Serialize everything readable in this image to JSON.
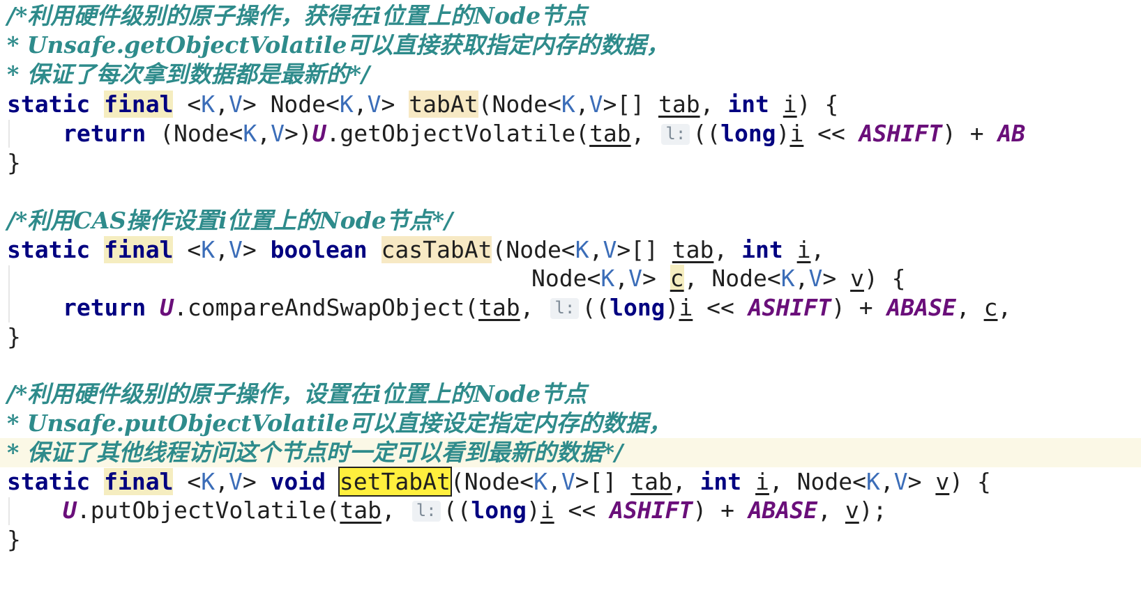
{
  "block1": {
    "c1": "/*利用硬件级别的原子操作，获得在i位置上的Node节点",
    "c2": "* Unsafe.getObjectVolatile可以直接获取指定内存的数据，",
    "c3": "* 保证了每次拿到数据都是最新的*/",
    "static": "static",
    "final": "final",
    "generics": "<K,V>",
    "type": "Node<K,V>",
    "name": "tabAt",
    "sig_open": "(Node<K,V>[] ",
    "p_tab": "tab",
    "comma": ", ",
    "int": "int",
    "p_i": "i",
    "sig_close": ") {",
    "return": "return",
    "cast": "(Node<K,V>)",
    "U": "U",
    "call": ".getObjectVolatile(",
    "hint": "l:",
    "long_open": "((",
    "long": "long",
    "long_close": ")",
    "shift": " << ",
    "ashift": "ASHIFT",
    "plus": ") + ",
    "abase_cut": "AB",
    "close": "}"
  },
  "block2": {
    "c1": "/*利用CAS操作设置i位置上的Node节点*/",
    "static": "static",
    "final": "final",
    "generics": "<K,V>",
    "boolean": "boolean",
    "name": "casTabAt",
    "sig_open": "(Node<K,V>[] ",
    "p_tab": "tab",
    "int": "int",
    "p_i": "i",
    "line2_type": "Node<K,V> ",
    "p_c": "c",
    "line2_type2": "Node<K,V> ",
    "p_v": "v",
    "sig_close": ") {",
    "return": "return",
    "U": "U",
    "call": ".compareAndSwapObject(",
    "hint": "l:",
    "long": "long",
    "ashift": "ASHIFT",
    "abase": "ABASE",
    "close": "}"
  },
  "block3": {
    "c1": "/*利用硬件级别的原子操作，设置在i位置上的Node节点",
    "c2": "* Unsafe.putObjectVolatile可以直接设定指定内存的数据，",
    "c3": "* 保证了其他线程访问这个节点时一定可以看到最新的数据*/",
    "static": "static",
    "final": "final",
    "generics": "<K,V>",
    "void": "void",
    "name": "setTabAt",
    "sig_open": "(Node<K,V>[] ",
    "p_tab": "tab",
    "int": "int",
    "p_i": "i",
    "node_type": "Node<K,V> ",
    "p_v": "v",
    "sig_close": ") {",
    "U": "U",
    "call": ".putObjectVolatile(",
    "hint": "l:",
    "long": "long",
    "ashift": "ASHIFT",
    "abase": "ABASE",
    "end": ");",
    "close": "}"
  }
}
